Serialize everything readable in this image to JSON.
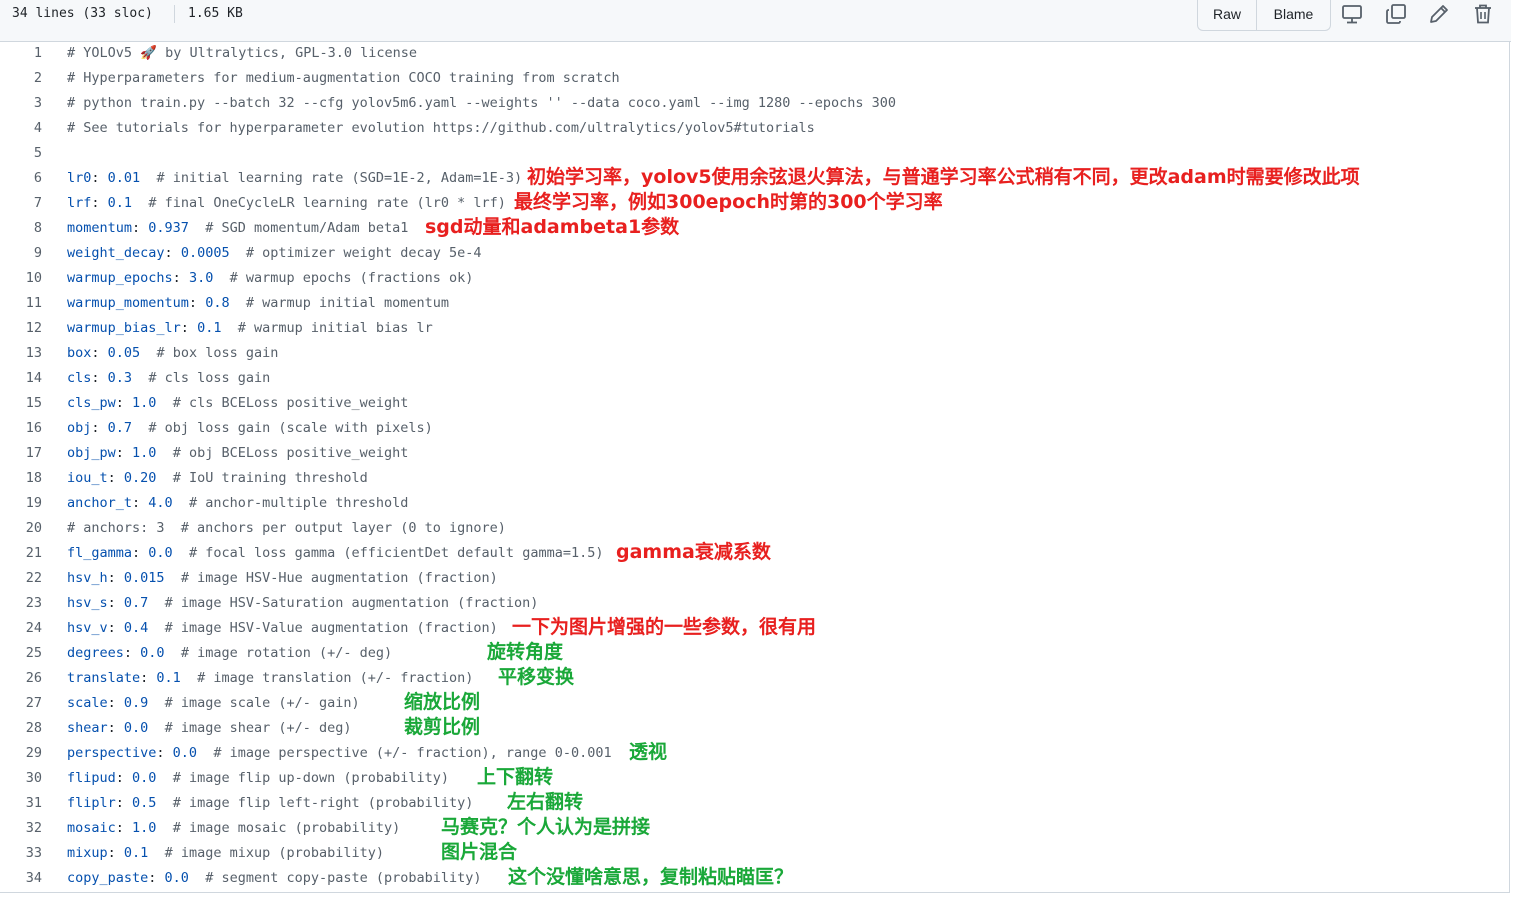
{
  "header": {
    "lines_info": "34 lines (33 sloc)",
    "size": "1.65 KB",
    "raw_label": "Raw",
    "blame_label": "Blame"
  },
  "icons": {
    "display": "desktop-icon",
    "copy": "copy-icon",
    "edit": "pencil-icon",
    "delete": "trash-icon"
  },
  "colors": {
    "annotation_red": "#e8201f",
    "annotation_green": "#1aa839",
    "code_key": "#0550ae",
    "code_comment": "#57606a"
  },
  "lines": [
    {
      "num": "1",
      "key": "",
      "val": "",
      "comment": "# YOLOv5 🚀 by Ultralytics, GPL-3.0 license"
    },
    {
      "num": "2",
      "key": "",
      "val": "",
      "comment": "# Hyperparameters for medium-augmentation COCO training from scratch"
    },
    {
      "num": "3",
      "key": "",
      "val": "",
      "comment": "# python train.py --batch 32 --cfg yolov5m6.yaml --weights '' --data coco.yaml --img 1280 --epochs 300"
    },
    {
      "num": "4",
      "key": "",
      "val": "",
      "comment": "# See tutorials for hyperparameter evolution https://github.com/ultralytics/yolov5#tutorials"
    },
    {
      "num": "5",
      "key": "",
      "val": "",
      "comment": ""
    },
    {
      "num": "6",
      "key": "lr0",
      "val": "0.01",
      "comment": "# initial learning rate (SGD=1E-2, Adam=1E-3)"
    },
    {
      "num": "7",
      "key": "lrf",
      "val": "0.1",
      "comment": "# final OneCycleLR learning rate (lr0 * lrf)"
    },
    {
      "num": "8",
      "key": "momentum",
      "val": "0.937",
      "comment": "# SGD momentum/Adam beta1"
    },
    {
      "num": "9",
      "key": "weight_decay",
      "val": "0.0005",
      "comment": "# optimizer weight decay 5e-4"
    },
    {
      "num": "10",
      "key": "warmup_epochs",
      "val": "3.0",
      "comment": "# warmup epochs (fractions ok)"
    },
    {
      "num": "11",
      "key": "warmup_momentum",
      "val": "0.8",
      "comment": "# warmup initial momentum"
    },
    {
      "num": "12",
      "key": "warmup_bias_lr",
      "val": "0.1",
      "comment": "# warmup initial bias lr"
    },
    {
      "num": "13",
      "key": "box",
      "val": "0.05",
      "comment": "# box loss gain"
    },
    {
      "num": "14",
      "key": "cls",
      "val": "0.3",
      "comment": "# cls loss gain"
    },
    {
      "num": "15",
      "key": "cls_pw",
      "val": "1.0",
      "comment": "# cls BCELoss positive_weight"
    },
    {
      "num": "16",
      "key": "obj",
      "val": "0.7",
      "comment": "# obj loss gain (scale with pixels)"
    },
    {
      "num": "17",
      "key": "obj_pw",
      "val": "1.0",
      "comment": "# obj BCELoss positive_weight"
    },
    {
      "num": "18",
      "key": "iou_t",
      "val": "0.20",
      "comment": "# IoU training threshold"
    },
    {
      "num": "19",
      "key": "anchor_t",
      "val": "4.0",
      "comment": "# anchor-multiple threshold"
    },
    {
      "num": "20",
      "key": "",
      "val": "",
      "comment": "# anchors: 3  # anchors per output layer (0 to ignore)"
    },
    {
      "num": "21",
      "key": "fl_gamma",
      "val": "0.0",
      "comment": "# focal loss gamma (efficientDet default gamma=1.5)"
    },
    {
      "num": "22",
      "key": "hsv_h",
      "val": "0.015",
      "comment": "# image HSV-Hue augmentation (fraction)"
    },
    {
      "num": "23",
      "key": "hsv_s",
      "val": "0.7",
      "comment": "# image HSV-Saturation augmentation (fraction)"
    },
    {
      "num": "24",
      "key": "hsv_v",
      "val": "0.4",
      "comment": "# image HSV-Value augmentation (fraction)"
    },
    {
      "num": "25",
      "key": "degrees",
      "val": "0.0",
      "comment": "# image rotation (+/- deg)"
    },
    {
      "num": "26",
      "key": "translate",
      "val": "0.1",
      "comment": "# image translation (+/- fraction)"
    },
    {
      "num": "27",
      "key": "scale",
      "val": "0.9",
      "comment": "# image scale (+/- gain)"
    },
    {
      "num": "28",
      "key": "shear",
      "val": "0.0",
      "comment": "# image shear (+/- deg)"
    },
    {
      "num": "29",
      "key": "perspective",
      "val": "0.0",
      "comment": "# image perspective (+/- fraction), range 0-0.001"
    },
    {
      "num": "30",
      "key": "flipud",
      "val": "0.0",
      "comment": "# image flip up-down (probability)"
    },
    {
      "num": "31",
      "key": "fliplr",
      "val": "0.5",
      "comment": "# image flip left-right (probability)"
    },
    {
      "num": "32",
      "key": "mosaic",
      "val": "1.0",
      "comment": "# image mosaic (probability)"
    },
    {
      "num": "33",
      "key": "mixup",
      "val": "0.1",
      "comment": "# image mixup (probability)"
    },
    {
      "num": "34",
      "key": "copy_paste",
      "val": "0.0",
      "comment": "# segment copy-paste (probability)"
    }
  ],
  "annotations": [
    {
      "line": 6,
      "text": "初始学习率，yolov5使用余弦退火算法，与普通学习率公式稍有不同，更改adam时需要修改此项",
      "color": "#e8201f"
    },
    {
      "line": 7,
      "text": "最终学习率，例如300epoch时第的300个学习率",
      "color": "#e8201f"
    },
    {
      "line": 8,
      "text": "sgd动量和adambeta1参数",
      "color": "#e8201f"
    },
    {
      "line": 21,
      "text": "gamma衰减系数",
      "color": "#e8201f"
    },
    {
      "line": 24,
      "text": "一下为图片增强的一些参数，很有用",
      "color": "#e8201f"
    },
    {
      "line": 25,
      "text": "旋转角度",
      "color": "#1aa839"
    },
    {
      "line": 26,
      "text": "平移变换",
      "color": "#1aa839"
    },
    {
      "line": 27,
      "text": "缩放比例",
      "color": "#1aa839"
    },
    {
      "line": 28,
      "text": "裁剪比例",
      "color": "#1aa839"
    },
    {
      "line": 29,
      "text": "透视",
      "color": "#1aa839"
    },
    {
      "line": 30,
      "text": "上下翻转",
      "color": "#1aa839"
    },
    {
      "line": 31,
      "text": "左右翻转",
      "color": "#1aa839"
    },
    {
      "line": 32,
      "text": "马赛克？个人认为是拼接",
      "color": "#1aa839"
    },
    {
      "line": 33,
      "text": "图片混合",
      "color": "#1aa839"
    },
    {
      "line": 34,
      "text": "这个没懂啥意思，复制粘贴瞄匡？",
      "color": "#1aa839"
    }
  ]
}
